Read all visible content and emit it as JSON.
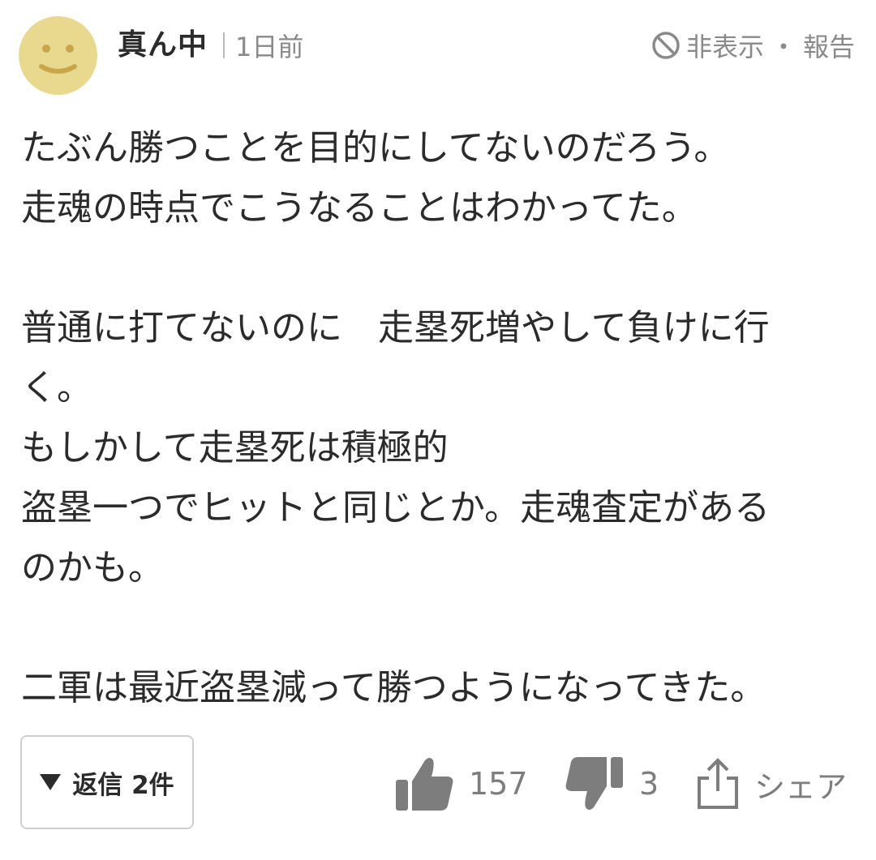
{
  "header": {
    "username": "真ん中",
    "timestamp": "1日前",
    "hide_label": "非表示",
    "separator": "・",
    "report_label": "報告"
  },
  "comment": {
    "lines": [
      "たぶん勝つことを目的にしてないのだろう。",
      "走魂の時点でこうなることはわかってた。",
      "",
      "普通に打てないのに　走塁死増やして負けに行",
      "く。",
      "もしかして走塁死は積極的",
      "盗塁一つでヒットと同じとか。走魂査定がある",
      "のかも。",
      "",
      "二軍は最近盗塁減って勝つようになってきた。"
    ]
  },
  "footer": {
    "reply_label": "返信 2件",
    "likes": "157",
    "dislikes": "3",
    "share_label": "シェア"
  },
  "colors": {
    "avatar": "#e9d98f",
    "avatar_face": "#c9a64a",
    "text": "#2b2b2b",
    "muted": "#8a8a8a",
    "icon": "#7d7d7d"
  }
}
